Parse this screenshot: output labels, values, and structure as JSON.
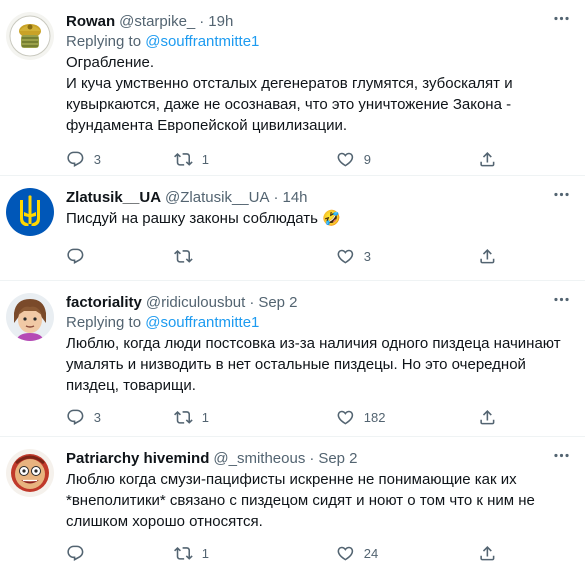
{
  "tweets": [
    {
      "name": "Rowan",
      "handle": "@starpike_",
      "time": "19h",
      "replying_prefix": "Replying to",
      "replying_to": "@souffrantmitte1",
      "text": "Ограбление.\nИ куча умственно отсталых дегенератов глумятся, зубоскалят и кувыркаются, даже не осознавая, что это уничтожение Закона - фундамента Европейской цивилизации.",
      "replies": "3",
      "retweets": "1",
      "likes": "9"
    },
    {
      "name": "Zlatusik__UA",
      "handle": "@Zlatusik__UA",
      "time": "14h",
      "text": "Писдуй на рашку законы соблюдать 🤣",
      "replies": "",
      "retweets": "",
      "likes": "3"
    },
    {
      "name": "factoriality",
      "handle": "@ridiculousbut",
      "time": "Sep 2",
      "replying_prefix": "Replying to",
      "replying_to": "@souffrantmitte1",
      "text": "Люблю, когда люди постсовка из-за наличия одного пиздеца начинают умалять и низводить в нет остальные пиздецы. Но это очередной пиздец, товарищи.",
      "replies": "3",
      "retweets": "1",
      "likes": "182"
    },
    {
      "name": "Patriarchy hivemind",
      "handle": "@_smitheous",
      "time": "Sep 2",
      "text": "Люблю когда смузи-пацифисты искренне не понимающие как их *внеполитики* связано с пиздецом сидят и ноют о том что к ним не слишком хорошо относятся.",
      "replies": "",
      "retweets": "1",
      "likes": "24"
    }
  ],
  "colors": {
    "text": "#0f1419",
    "secondary": "#536471",
    "link": "#1d9bf0",
    "divider": "#eff3f4"
  },
  "icons": [
    "reply-icon",
    "retweet-icon",
    "like-icon",
    "share-icon",
    "more-icon"
  ]
}
